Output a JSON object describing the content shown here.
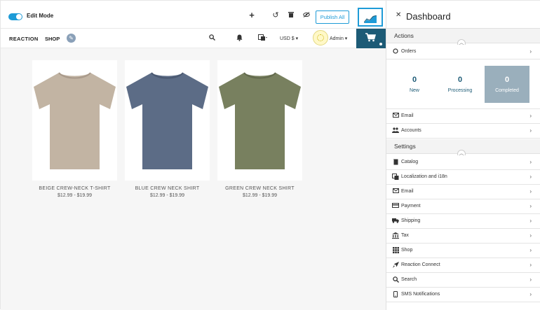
{
  "editbar": {
    "edit_mode_label": "Edit Mode",
    "publish_label": "Publish All",
    "icons": [
      "plus-icon",
      "undo-icon",
      "trash-icon",
      "eye-off-icon",
      "chart-icon"
    ]
  },
  "navbar": {
    "brand": "REACTION",
    "shop": "SHOP",
    "currency": "USD $",
    "admin": "Admin",
    "icons": [
      "pencil-icon",
      "search-icon",
      "bell-icon",
      "language-icon",
      "cart-icon"
    ]
  },
  "products": [
    {
      "title": "BEIGE CREW-NECK T-SHIRT",
      "price": "$12.99 - $19.99",
      "color": "#c2b4a3"
    },
    {
      "title": "BLUE CREW NECK SHIRT",
      "price": "$12.99 - $19.99",
      "color": "#5c6c86"
    },
    {
      "title": "GREEN CREW NECK SHIRT",
      "price": "$12.99 - $19.99",
      "color": "#78805f"
    }
  ],
  "dashboard": {
    "title": "Dashboard",
    "actions": {
      "label": "Actions",
      "orders": "Orders",
      "stats": [
        {
          "value": "0",
          "label": "New"
        },
        {
          "value": "0",
          "label": "Processing"
        },
        {
          "value": "0",
          "label": "Completed"
        }
      ],
      "items": [
        "Email",
        "Accounts"
      ]
    },
    "settings": {
      "label": "Settings",
      "items": [
        "Catalog",
        "Localization and i18n",
        "Email",
        "Payment",
        "Shipping",
        "Tax",
        "Shop",
        "Reaction Connect",
        "Search",
        "SMS Notifications"
      ]
    }
  },
  "colors": {
    "accent": "#1e9bd7",
    "dark_blue": "#1d5b76",
    "active_stat": "#9aafbc"
  }
}
